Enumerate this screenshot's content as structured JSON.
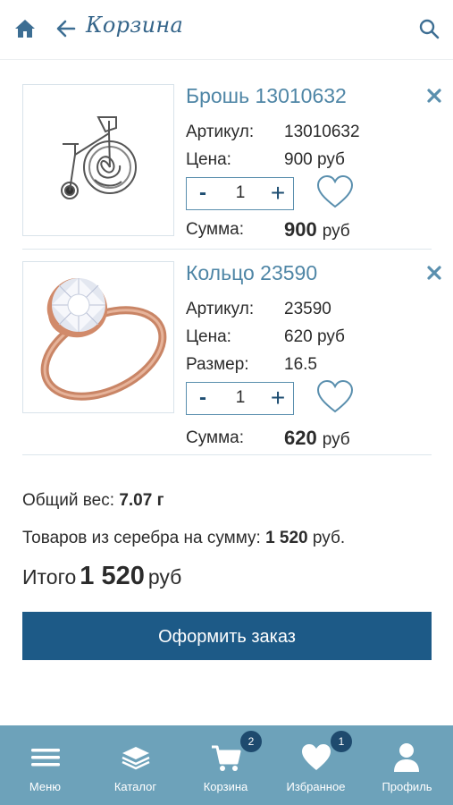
{
  "header": {
    "title": "Корзина",
    "home_icon": "home-icon",
    "back_icon": "arrow-left-icon",
    "search_icon": "search-icon"
  },
  "items": [
    {
      "name": "Брошь 13010632",
      "article_label": "Артикул:",
      "article": "13010632",
      "price_label": "Цена:",
      "price": "900 руб",
      "quantity": "1",
      "sum_label": "Сумма:",
      "sum": "900",
      "currency": "руб"
    },
    {
      "name": "Кольцо 23590",
      "article_label": "Артикул:",
      "article": "23590",
      "price_label": "Цена:",
      "price": "620 руб",
      "size_label": "Размер:",
      "size": "16.5",
      "quantity": "1",
      "sum_label": "Сумма:",
      "sum": "620",
      "currency": "руб"
    }
  ],
  "summary": {
    "weight_label": "Общий вес:",
    "weight": "7.07 г",
    "silver_label": "Товаров из серебра на сумму:",
    "silver_sum": "1 520",
    "silver_cur": "руб.",
    "total_label": "Итого",
    "total": "1 520",
    "total_cur": "руб"
  },
  "checkout_label": "Оформить заказ",
  "tabbar": {
    "menu": "Меню",
    "catalog": "Каталог",
    "cart": "Корзина",
    "cart_badge": "2",
    "favorites": "Избранное",
    "favorites_badge": "1",
    "profile": "Профиль"
  },
  "colors": {
    "accent": "#1d5a87",
    "tabbar": "#6da2ba",
    "link": "#4f86a6"
  }
}
